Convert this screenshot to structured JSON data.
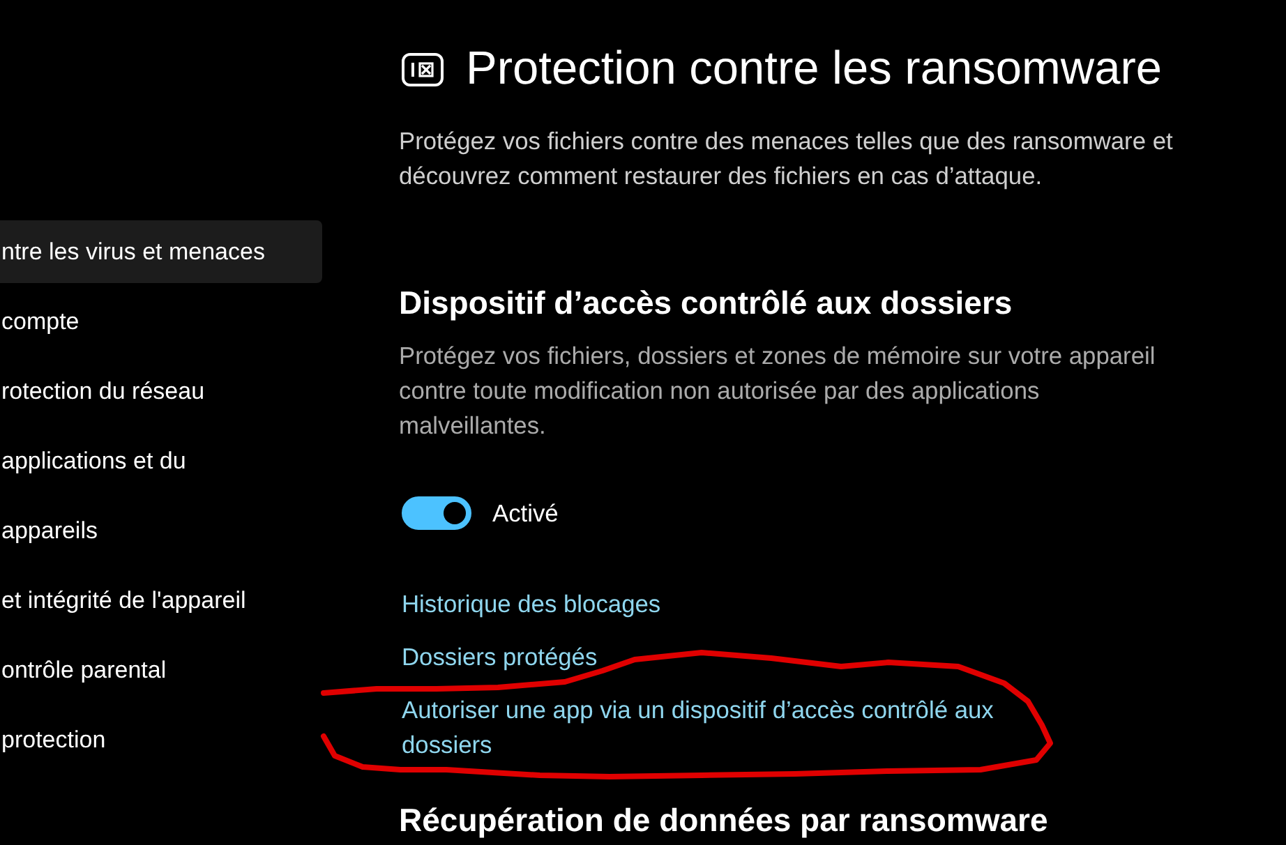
{
  "sidebar": {
    "items": [
      {
        "label": "ntre les virus et menaces",
        "selected": true
      },
      {
        "label": "compte",
        "selected": false
      },
      {
        "label": "rotection du réseau",
        "selected": false
      },
      {
        "label": "applications et du",
        "selected": false
      },
      {
        "label": "appareils",
        "selected": false
      },
      {
        "label": "et intégrité de l'appareil",
        "selected": false
      },
      {
        "label": "ontrôle parental",
        "selected": false
      },
      {
        "label": "protection",
        "selected": false
      }
    ]
  },
  "page": {
    "title": "Protection contre les ransomware",
    "description": "Protégez vos fichiers contre des menaces telles que des ransomware et découvrez comment restaurer des fichiers en cas d’attaque."
  },
  "sections": [
    {
      "heading": "Dispositif d’accès contrôlé aux dossiers",
      "description": "Protégez vos fichiers, dossiers et zones de mémoire sur votre appareil contre toute modification non autorisée par des applications malveillantes.",
      "toggle": {
        "on": true,
        "label": "Activé"
      },
      "links": [
        "Historique des blocages",
        "Dossiers protégés",
        "Autoriser une app via un dispositif d’accès contrôlé aux dossiers"
      ]
    },
    {
      "heading": "Récupération de données par ransomware"
    }
  ],
  "annotations": [
    {
      "kind": "scribble"
    }
  ]
}
